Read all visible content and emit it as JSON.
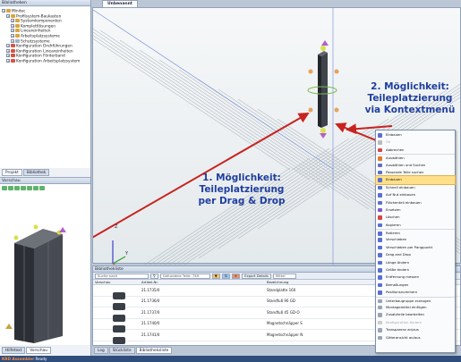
{
  "left_panel": {
    "library_title": "Bibliotheken",
    "tree": [
      {
        "label": "Minitec",
        "level": 0,
        "color": "#d9a441"
      },
      {
        "label": "Profilsystem-Baukasten",
        "level": 1,
        "color": "#d9a441"
      },
      {
        "label": "Systemkomponenten",
        "level": 2,
        "color": "#d9a441"
      },
      {
        "label": "Komplettlösungen",
        "level": 2,
        "color": "#d9a441"
      },
      {
        "label": "Lineareinheiten",
        "level": 2,
        "color": "#d9a441"
      },
      {
        "label": "Arbeitsplatzsysteme",
        "level": 2,
        "color": "#d9a441"
      },
      {
        "label": "Schutzsysteme",
        "level": 2,
        "color": "#9fb0c6"
      },
      {
        "label": "Konfiguration Drehführungen",
        "level": 1,
        "color": "#d4544a"
      },
      {
        "label": "Konfiguration Lineareinheiten",
        "level": 1,
        "color": "#d4544a"
      },
      {
        "label": "Konfiguration Förderband",
        "level": 1,
        "color": "#d4544a"
      },
      {
        "label": "Konfiguration Arbeitsplatzsystem",
        "level": 1,
        "color": "#d4544a"
      }
    ],
    "tabs": [
      "Projekt",
      "Bibliothek"
    ],
    "preview_title": "Vorschau",
    "bottom_tabs": [
      "Hilfetext",
      "Vorschau"
    ]
  },
  "main": {
    "document_tab": "Unbenannt",
    "annotation_1": {
      "line1": "1. Möglichkeit:",
      "line2": "Teileplatzierung",
      "line3": "per Drag & Drop"
    },
    "annotation_2": {
      "line1": "2. Möglichkeit:",
      "line2": "Teileplatzierung",
      "line3": "via Kontextmenü"
    },
    "axis_z": "Z",
    "axis_y": "Y"
  },
  "context_menu": {
    "items": [
      {
        "label": "Einbauen",
        "disabled": false,
        "color": "#5a6fd0"
      },
      {
        "label": "Ok",
        "disabled": true,
        "color": "#bbbbbb"
      },
      {
        "label": "Abbrechen",
        "disabled": false,
        "color": "#d64646"
      },
      {
        "label": "Auswählen",
        "disabled": false,
        "color": "#e07a2e"
      },
      {
        "label": "Auswählen und Suchen",
        "disabled": false,
        "color": "#5a6fd0"
      },
      {
        "label": "Passende Teile suchen",
        "disabled": false,
        "color": "#5a6fd0"
      },
      {
        "label": "Einbauen",
        "disabled": false,
        "highlight": true,
        "color": "#5a6fd0"
      },
      {
        "label": "Schnell einbauen",
        "disabled": false,
        "color": "#5a6fd0"
      },
      {
        "label": "Auf Nut einbauen",
        "disabled": false,
        "color": "#5a6fd0"
      },
      {
        "label": "Flächenteil einbauen",
        "disabled": false,
        "color": "#5a6fd0"
      },
      {
        "label": "Ersetzen",
        "disabled": false,
        "color": "#7a58c8"
      },
      {
        "label": "Löschen",
        "disabled": false,
        "color": "#d64646"
      },
      {
        "label": "Kopieren",
        "disabled": false,
        "color": "#5a6fd0"
      },
      {
        "label": "Rotieren",
        "disabled": false,
        "color": "#5a6fd0"
      },
      {
        "label": "Verschieben",
        "disabled": false,
        "color": "#5a6fd0"
      },
      {
        "label": "Verschieben per Pangpunkt",
        "disabled": false,
        "color": "#5a6fd0"
      },
      {
        "label": "Drag and Drop",
        "disabled": false,
        "color": "#5a6fd0"
      },
      {
        "label": "Länge ändern",
        "disabled": false,
        "color": "#5a6fd0"
      },
      {
        "label": "Größe ändern",
        "disabled": false,
        "color": "#5a6fd0"
      },
      {
        "label": "Entfernung messen",
        "disabled": false,
        "color": "#5a6fd0"
      },
      {
        "label": "Bemaßungen",
        "disabled": false,
        "color": "#5a6fd0"
      },
      {
        "label": "Positionsnummern",
        "disabled": false,
        "color": "#5a6fd0"
      },
      {
        "label": "Unterbaugruppe erzeugen",
        "disabled": false,
        "color": "#9aa4b2"
      },
      {
        "label": "Montagemittel einfügen",
        "disabled": false,
        "color": "#9aa4b2"
      },
      {
        "label": "Zusatzteile bearbeiten",
        "disabled": false,
        "color": "#9aa4b2"
      },
      {
        "label": "Konfiguration ändern",
        "disabled": true,
        "color": "#cccccc"
      },
      {
        "label": "Transparenz an/aus",
        "disabled": false,
        "color": "#9aa4b2"
      },
      {
        "label": "Gitteransicht an/aus",
        "disabled": false,
        "color": "#9aa4b2"
      }
    ]
  },
  "library_panel": {
    "title": "Bibliothekliste",
    "search_placeholder": "Suche nach",
    "found_text": "Gefundene Teile: 749",
    "export_label": "Export Details",
    "filter_value": "Mittel",
    "columns": [
      "Vorschau",
      "Artikel-Nr.",
      "Bezeichnung"
    ],
    "rows": [
      {
        "artikel": "21.1735/0",
        "bezeichnung": "Standplatte 160"
      },
      {
        "artikel": "21.1736/0",
        "bezeichnung": "Standfuß 90 GD"
      },
      {
        "artikel": "21.1737/0",
        "bezeichnung": "Standfuß 45 GD-O"
      },
      {
        "artikel": "21.1740/0",
        "bezeichnung": "Magnetschnäpper S"
      },
      {
        "artikel": "21.1741/0",
        "bezeichnung": "Magnetschnäpper N"
      }
    ],
    "bottom_tabs": [
      "Log",
      "Stückliste",
      "Bibliotheksliste"
    ]
  },
  "status_bar": {
    "app": "KRD Assembler",
    "state": "Ready"
  }
}
